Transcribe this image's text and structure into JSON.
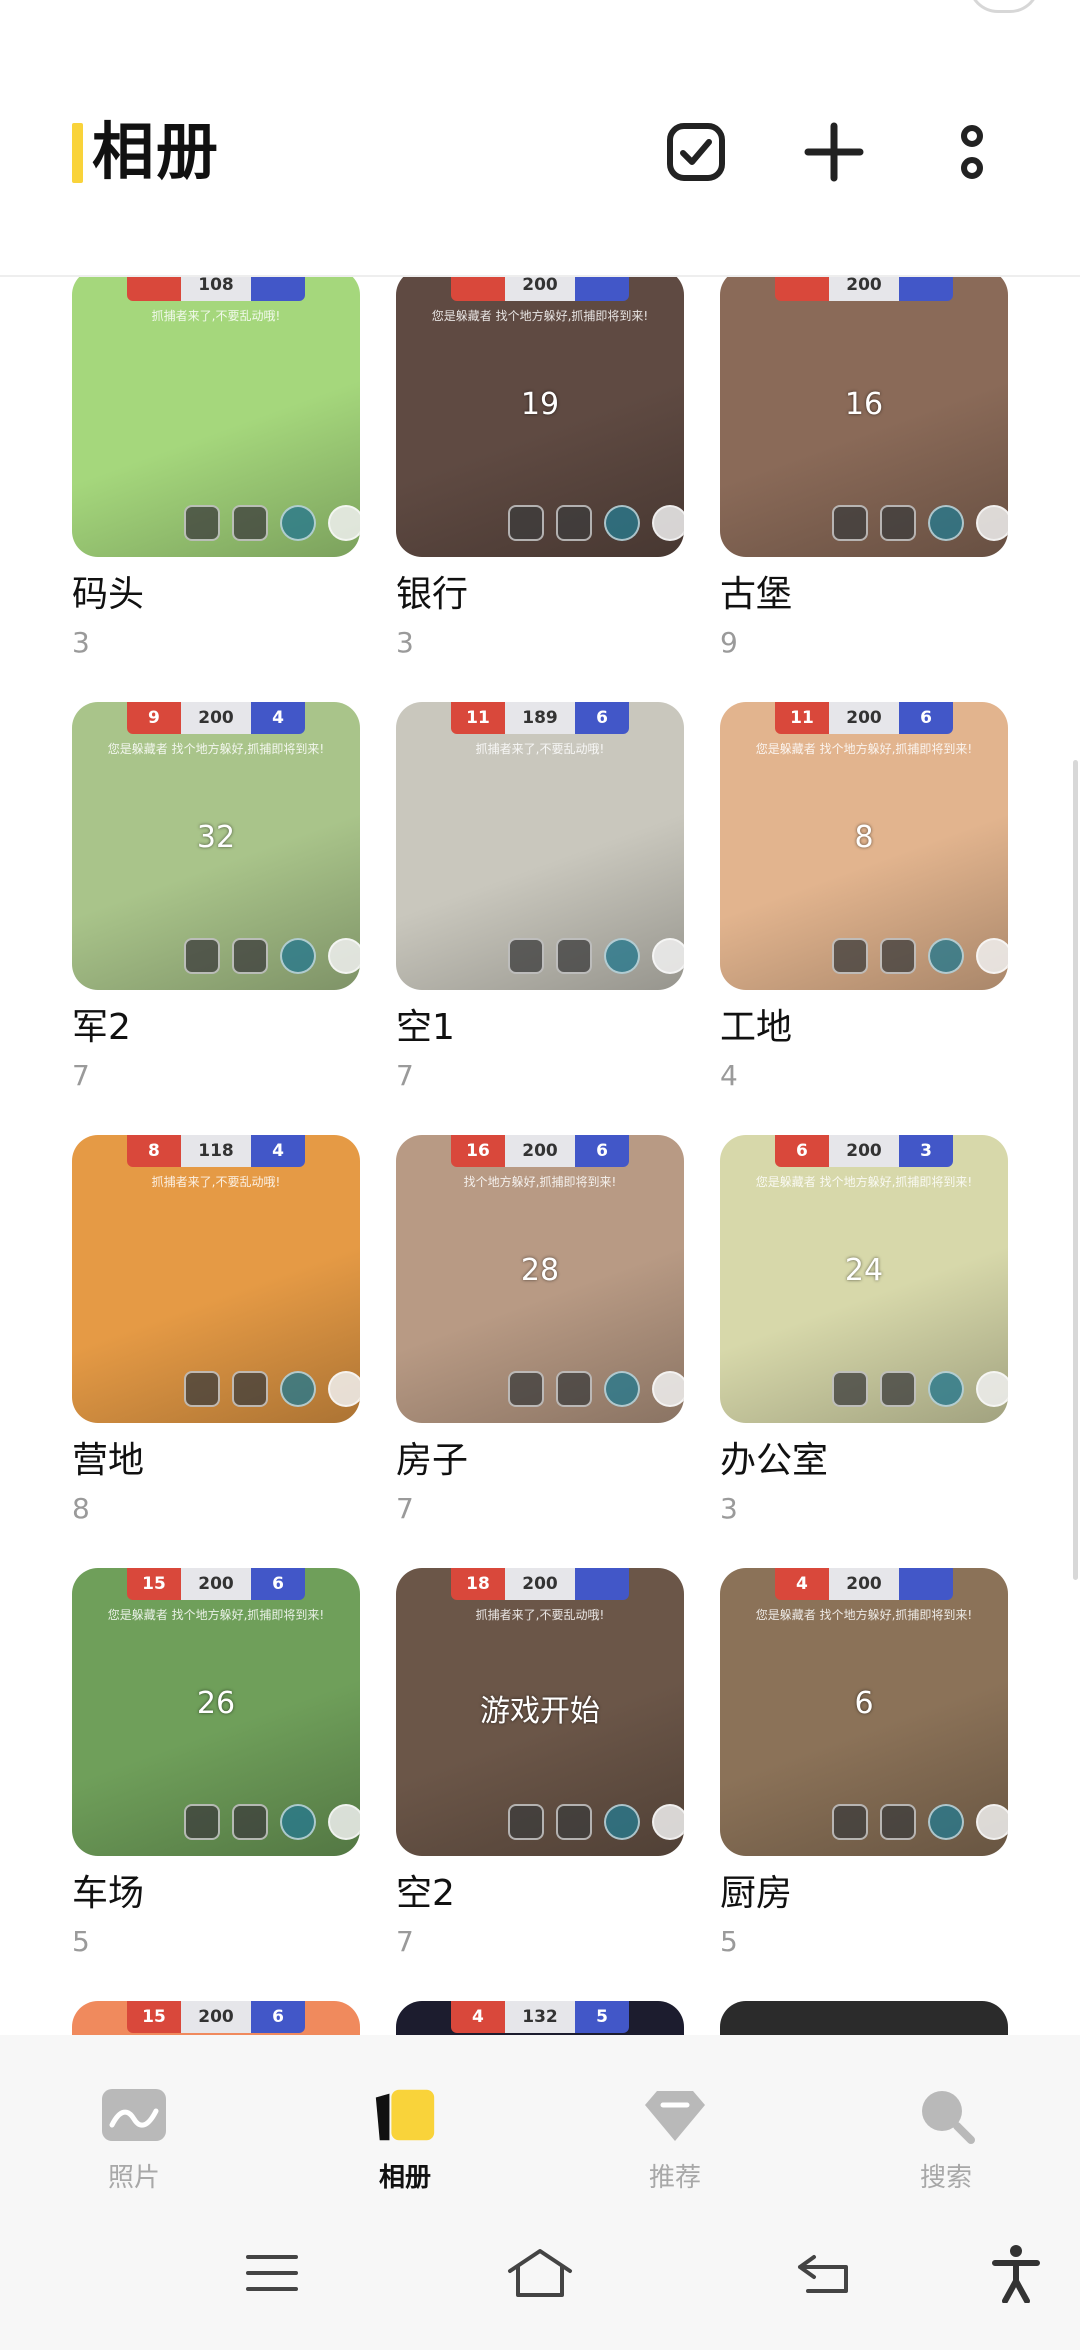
{
  "header": {
    "title": "相册"
  },
  "albums": [
    {
      "name": "码头",
      "count": "3",
      "thumb": {
        "bg": "#a5d77c",
        "hud_left": "",
        "hud_mid": "108",
        "hud_right": "",
        "number": "",
        "msg": "抓捕者来了,不要乱动哦!"
      }
    },
    {
      "name": "银行",
      "count": "3",
      "thumb": {
        "bg": "#5f4a42",
        "hud_left": "",
        "hud_mid": "200",
        "hud_right": "",
        "number": "19",
        "msg": "您是躲藏者 找个地方躲好,抓捕即将到来!"
      }
    },
    {
      "name": "古堡",
      "count": "9",
      "thumb": {
        "bg": "#8a6a58",
        "hud_left": "",
        "hud_mid": "200",
        "hud_right": "",
        "number": "16",
        "msg": ""
      }
    },
    {
      "name": "军2",
      "count": "7",
      "thumb": {
        "bg": "#a9c48a",
        "hud_left": "9",
        "hud_mid": "200",
        "hud_right": "4",
        "number": "32",
        "msg": "您是躲藏者 找个地方躲好,抓捕即将到来!"
      }
    },
    {
      "name": "空1",
      "count": "7",
      "thumb": {
        "bg": "#c9c7bd",
        "hud_left": "11",
        "hud_mid": "189",
        "hud_right": "6",
        "number": "",
        "msg": "抓捕者来了,不要乱动哦!"
      }
    },
    {
      "name": "工地",
      "count": "4",
      "thumb": {
        "bg": "#e2b48e",
        "hud_left": "11",
        "hud_mid": "200",
        "hud_right": "6",
        "number": "8",
        "msg": "您是躲藏者 找个地方躲好,抓捕即将到来!"
      }
    },
    {
      "name": "营地",
      "count": "8",
      "thumb": {
        "bg": "#e59a45",
        "hud_left": "8",
        "hud_mid": "118",
        "hud_right": "4",
        "number": "",
        "msg": "抓捕者来了,不要乱动哦!"
      }
    },
    {
      "name": "房子",
      "count": "7",
      "thumb": {
        "bg": "#b89a84",
        "hud_left": "16",
        "hud_mid": "200",
        "hud_right": "6",
        "number": "28",
        "msg": "找个地方躲好,抓捕即将到来!"
      }
    },
    {
      "name": "办公室",
      "count": "3",
      "thumb": {
        "bg": "#d7d8aa",
        "hud_left": "6",
        "hud_mid": "200",
        "hud_right": "3",
        "number": "24",
        "msg": "您是躲藏者 找个地方躲好,抓捕即将到来!"
      }
    },
    {
      "name": "车场",
      "count": "5",
      "thumb": {
        "bg": "#6f9f5a",
        "hud_left": "15",
        "hud_mid": "200",
        "hud_right": "6",
        "number": "26",
        "msg": "您是躲藏者 找个地方躲好,抓捕即将到来!"
      }
    },
    {
      "name": "空2",
      "count": "7",
      "thumb": {
        "bg": "#6b5648",
        "hud_left": "18",
        "hud_mid": "200",
        "hud_right": "",
        "number": "游戏开始",
        "msg": "抓捕者来了,不要乱动哦!"
      }
    },
    {
      "name": "厨房",
      "count": "5",
      "thumb": {
        "bg": "#8b7258",
        "hud_left": "4",
        "hud_mid": "200",
        "hud_right": "",
        "number": "6",
        "msg": "您是躲藏者 找个地方躲好,抓捕即将到来!"
      }
    },
    {
      "name": "",
      "count": "",
      "thumb": {
        "bg": "#f08a5d",
        "hud_left": "15",
        "hud_mid": "200",
        "hud_right": "6",
        "number": "",
        "msg": ""
      }
    },
    {
      "name": "",
      "count": "",
      "thumb": {
        "bg": "#1c1c2e",
        "hud_left": "4",
        "hud_mid": "132",
        "hud_right": "5",
        "number": "",
        "msg": ""
      }
    },
    {
      "name": "",
      "count": "",
      "thumb": {
        "bg": "#2b2b2b",
        "hud_left": "",
        "hud_mid": "",
        "hud_right": "",
        "number": "",
        "msg": ""
      }
    }
  ],
  "tabs": [
    {
      "label": "照片",
      "icon": "photos-icon",
      "active": false
    },
    {
      "label": "相册",
      "icon": "albums-icon",
      "active": true
    },
    {
      "label": "推荐",
      "icon": "recommend-diamond-icon",
      "active": false
    },
    {
      "label": "搜索",
      "icon": "search-icon",
      "active": false
    }
  ],
  "colors": {
    "accent": "#f9d33a",
    "inactive": "#a8a8a8",
    "count": "#9a9a9a"
  }
}
